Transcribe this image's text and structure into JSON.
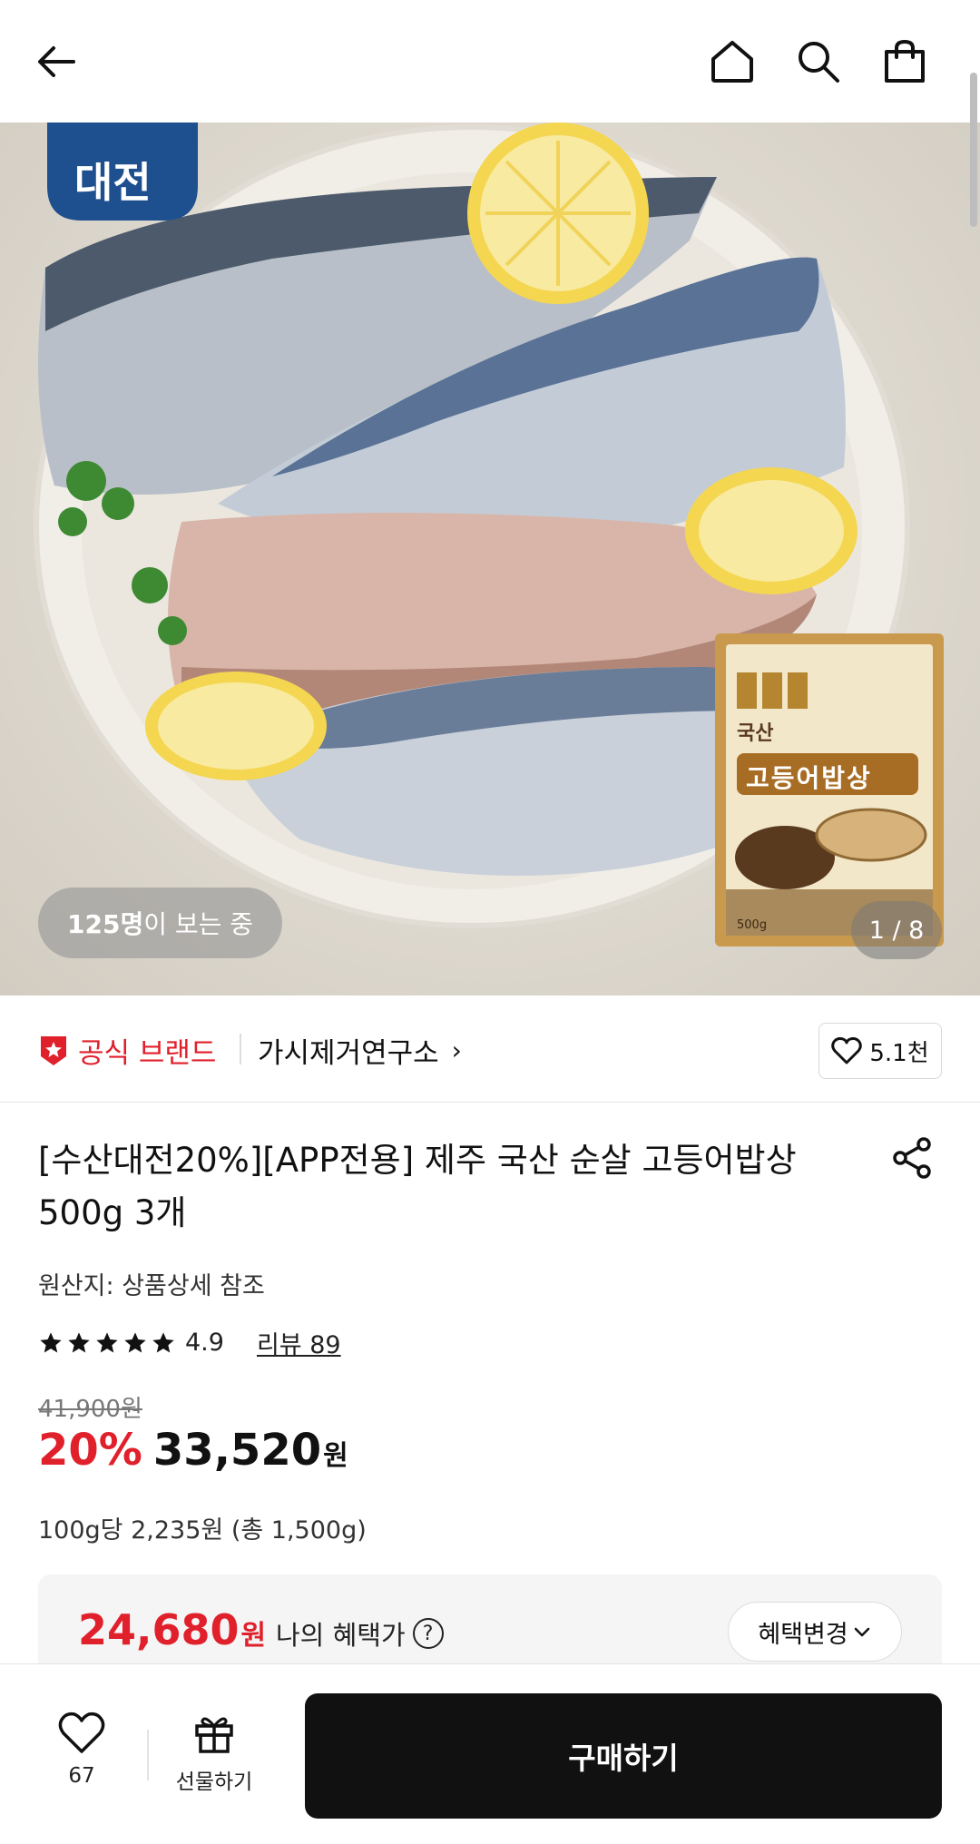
{
  "header": {
    "icons": [
      "back-arrow-icon",
      "home-icon",
      "search-icon",
      "shopping-bag-icon"
    ]
  },
  "hero": {
    "badge_text": "대전",
    "package_label_small": "국산",
    "package_label_title": "고등어밥상",
    "package_weight": "500g",
    "viewers_count": "125명",
    "viewers_suffix": "이 보는 중",
    "page_indicator": "1 / 8"
  },
  "brand": {
    "official_label": "공식 브랜드",
    "name": "가시제거연구소",
    "likes": "5.1천"
  },
  "product": {
    "title": "[수산대전20%][APP전용] 제주 국산 순살 고등어밥상 500g 3개",
    "origin": "원산지: 상품상세 참조",
    "rating": "4.9",
    "stars": 5,
    "reviews": "리뷰 89",
    "original_price": "41,900원",
    "discount": "20%",
    "price": "33,520",
    "price_unit": "원",
    "unit_price": "100g당 2,235원 (총 1,500g)"
  },
  "benefit": {
    "price": "24,680",
    "price_unit": "원",
    "label": "나의 혜택가",
    "change_label": "혜택변경"
  },
  "bottom": {
    "wish_count": "67",
    "gift_label": "선물하기",
    "buy_label": "구매하기"
  },
  "colors": {
    "accent_red": "#e0202b",
    "buy_button": "#111111"
  }
}
